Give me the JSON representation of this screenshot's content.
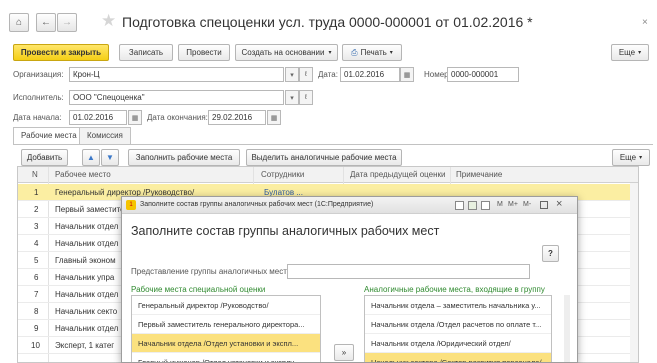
{
  "window": {
    "title": "Подготовка спецоценки усл. труда 0000-000001 от 01.02.2016 *"
  },
  "toolbar": {
    "post_close": "Провести и закрыть",
    "save": "Записать",
    "post": "Провести",
    "create_based": "Создать на основании",
    "print": "Печать",
    "more": "Еще"
  },
  "form": {
    "org_label": "Организация:",
    "org_value": "Крон-Ц",
    "date_label": "Дата:",
    "date_value": "01.02.2016",
    "number_label": "Номер:",
    "number_value": "0000-000001",
    "executor_label": "Исполнитель:",
    "executor_value": "ООО \"Спецоценка\"",
    "start_label": "Дата начала:",
    "start_value": "01.02.2016",
    "end_label": "Дата окончания:",
    "end_value": "29.02.2016"
  },
  "tabs": [
    "Рабочие места",
    "Комиссия"
  ],
  "table_toolbar": {
    "add": "Добавить",
    "fill": "Заполнить рабочие места",
    "select_similar": "Выделить аналогичные рабочие места",
    "more": "Еще"
  },
  "table": {
    "columns": [
      "N",
      "Рабочее место",
      "Сотрудники",
      "Дата предыдущей оценки",
      "Примечание"
    ],
    "rows": [
      {
        "n": "1",
        "place": "Генеральный директор /Руководство/",
        "staff": "Булатов ..."
      },
      {
        "n": "2",
        "place": "Первый заместите",
        "staff": ""
      },
      {
        "n": "3",
        "place": "Начальник отдел",
        "staff": ""
      },
      {
        "n": "4",
        "place": "Начальник отдел",
        "staff": ""
      },
      {
        "n": "5",
        "place": "Главный эконом",
        "staff": ""
      },
      {
        "n": "6",
        "place": "Начальник упра",
        "staff": ""
      },
      {
        "n": "7",
        "place": "Начальник отдел",
        "staff": ""
      },
      {
        "n": "8",
        "place": "Начальник секто",
        "staff": ""
      },
      {
        "n": "9",
        "place": "Начальник отдел",
        "staff": ""
      },
      {
        "n": "10",
        "place": "Эксперт, 1 катег",
        "staff": ""
      }
    ]
  },
  "dialog": {
    "title": "Заполните состав группы аналогичных рабочих мест (1С:Предприятие)",
    "header": "Заполните состав группы аналогичных рабочих мест",
    "help": "?",
    "group_label": "Представление группы аналогичных мест:",
    "group_value": "",
    "left_caption": "Рабочие места специальной оценки",
    "right_caption": "Аналогичные рабочие места, входящие в группу",
    "move_right": "»",
    "tb_m": "M",
    "tb_mplus": "M+",
    "tb_mminus": "M-",
    "left_items": [
      "Генеральный директор /Руководство/",
      "Первый заместитель генерального директора...",
      "Начальник отдела /Отдел установки и экспл...",
      "Главный инженер /Отдел установки и эксплу..."
    ],
    "right_items": [
      "Начальник отдела – заместитель начальника у...",
      "Начальник отдела /Отдел расчетов по оплате т...",
      "Начальник отдела /Юридический отдел/",
      "Начальник сектора /Сектор развития персонала/"
    ]
  },
  "colors": {
    "accent": "#f5cf15",
    "selected_row": "#fbeea2",
    "link": "#2c5aa0",
    "green_caption": "#2f8a2f"
  }
}
